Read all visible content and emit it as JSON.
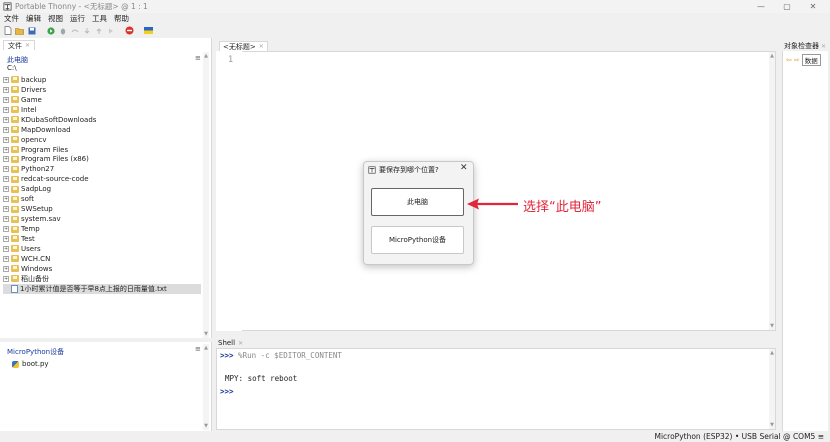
{
  "window": {
    "title": "Portable Thonny  -  <无标题>  @  1 : 1",
    "minimize": "—",
    "maximize": "▢",
    "close": "✕"
  },
  "menu": [
    "文件",
    "编辑",
    "视图",
    "运行",
    "工具",
    "帮助"
  ],
  "toolbar_icons": [
    "new-file-icon",
    "open-file-icon",
    "save-icon",
    "run-icon",
    "debug-icon",
    "step-over-icon",
    "step-into-icon",
    "step-out-icon",
    "resume-icon",
    "stop-icon",
    "flag-icon"
  ],
  "files_panel": {
    "tab_label": "文件",
    "location_title": "此电脑",
    "menu_glyph": "≡",
    "path": "C:\\",
    "items": [
      {
        "name": "backup",
        "type": "folder"
      },
      {
        "name": "Drivers",
        "type": "folder"
      },
      {
        "name": "Game",
        "type": "folder"
      },
      {
        "name": "Intel",
        "type": "folder"
      },
      {
        "name": "KDubaSoftDownloads",
        "type": "folder"
      },
      {
        "name": "MapDownload",
        "type": "folder"
      },
      {
        "name": "opencv",
        "type": "folder"
      },
      {
        "name": "Program Files",
        "type": "folder"
      },
      {
        "name": "Program Files (x86)",
        "type": "folder"
      },
      {
        "name": "Python27",
        "type": "folder"
      },
      {
        "name": "redcat-source-code",
        "type": "folder"
      },
      {
        "name": "SadpLog",
        "type": "folder"
      },
      {
        "name": "soft",
        "type": "folder"
      },
      {
        "name": "SWSetup",
        "type": "folder"
      },
      {
        "name": "system.sav",
        "type": "folder"
      },
      {
        "name": "Temp",
        "type": "folder"
      },
      {
        "name": "Test",
        "type": "folder"
      },
      {
        "name": "Users",
        "type": "folder"
      },
      {
        "name": "WCH.CN",
        "type": "folder"
      },
      {
        "name": "Windows",
        "type": "folder"
      },
      {
        "name": "稻山备份",
        "type": "folder"
      },
      {
        "name": "1小时累计值是否等于早8点上报的日雨量值.txt",
        "type": "file"
      }
    ]
  },
  "device_panel": {
    "title": "MicroPython设备",
    "menu_glyph": "≡",
    "files": [
      "boot.py"
    ]
  },
  "editor": {
    "tab_label": "<无标题>",
    "line_number": "1"
  },
  "shell": {
    "tab_label": "Shell",
    "prompt": ">>>",
    "command": " %Run -c $EDITOR_CONTENT",
    "output": "MPY: soft reboot"
  },
  "variables_panel": {
    "tab_label": "对象检查器",
    "button_label": "数据"
  },
  "status": {
    "text": "MicroPython (ESP32)  •  USB Serial @ COM5  ≡"
  },
  "dialog": {
    "title": "要保存到哪个位置?",
    "close": "✕",
    "option_1": "此电脑",
    "option_2": "MicroPython设备"
  },
  "annotation": {
    "text": "选择“此电脑”",
    "color": "#e0273b"
  }
}
